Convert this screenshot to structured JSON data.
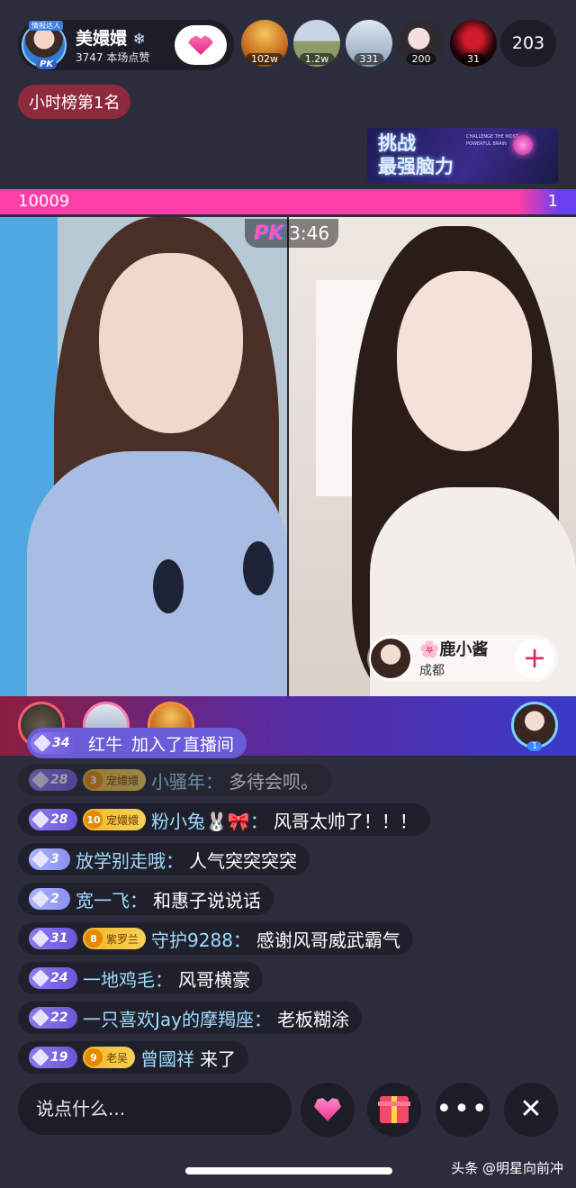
{
  "host": {
    "name": "美嬛嬛",
    "likes": "3747 本场点赞",
    "badge": "PK",
    "ribbon": "情报达人"
  },
  "viewers": [
    {
      "count": "102w",
      "color": "#d98a2c"
    },
    {
      "count": "1.2w",
      "color": "#8d9a6a"
    },
    {
      "count": "331",
      "color": "#9fb2c8"
    },
    {
      "count": "200",
      "color": "#d7c7c9"
    },
    {
      "count": "31",
      "color": "#5b1018"
    }
  ],
  "viewer_total": "203",
  "rank_badge": "小时榜第1名",
  "promo": {
    "main_line1": "挑战",
    "main_line2": "最强脑力",
    "sub": "CHALLENGE THE MOST POWERFUL BRAIN"
  },
  "pk": {
    "left_score": "10009",
    "right_score": "1",
    "logo": "PK",
    "timer": "3:46",
    "left_ratio": 0.9999
  },
  "opponent": {
    "name": "🌸鹿小酱",
    "location": "成都",
    "add_symbol": "+"
  },
  "host_mini_count": "1",
  "join_notice": {
    "level": "34",
    "user": "红牛",
    "text": "加入了直播间"
  },
  "chat": [
    {
      "level": "28",
      "fan_level": "3",
      "fan_name": "宠嬛嬛",
      "user": "小骚年：",
      "msg": "多待会呗。",
      "faded": true
    },
    {
      "level": "28",
      "fan_level": "10",
      "fan_name": "宠嬛嬛",
      "user": "粉小兔🐰🎀：",
      "msg": "风哥太帅了！！！"
    },
    {
      "level": "3",
      "user": "放学别走哦：",
      "msg": "人气突突突突"
    },
    {
      "level": "2",
      "user": "宽一飞：",
      "msg": "和惠子说说话"
    },
    {
      "level": "31",
      "fan_level": "8",
      "fan_name": "紫罗兰",
      "user": "守护9288：",
      "msg": "感谢风哥威武霸气"
    },
    {
      "level": "24",
      "user": "一地鸡毛：",
      "msg": "风哥横豪"
    },
    {
      "level": "22",
      "user": "一只喜欢Jay的摩羯座：",
      "msg": "老板糊涂"
    },
    {
      "level": "19",
      "fan_level": "9",
      "fan_name": "老吴",
      "user": "曾國祥",
      "msg": "来了"
    }
  ],
  "input_placeholder": "说点什么...",
  "buttons": {
    "more": "•••",
    "close": "✕"
  },
  "watermark": "头条 @明星向前冲",
  "icons": [
    "snowflake-icon",
    "heart-icon",
    "pk-icon",
    "add-icon",
    "diamond-icon",
    "heart-planet-icon",
    "gift-icon",
    "more-icon",
    "close-icon"
  ]
}
